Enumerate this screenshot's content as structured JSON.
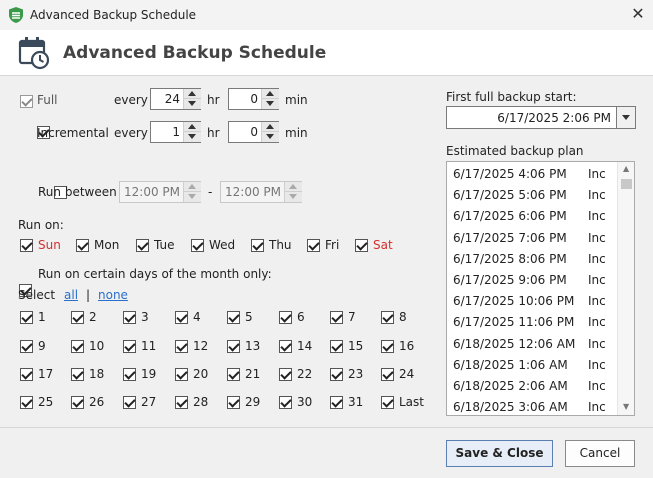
{
  "window": {
    "title": "Advanced Backup Schedule",
    "header_title": "Advanced Backup Schedule",
    "close_glyph": "✕",
    "accent_color": "#3a9a4a"
  },
  "full": {
    "label": "Full",
    "checked": true,
    "disabled": true,
    "every_label": "every",
    "hours": "24",
    "hr_label": "hr",
    "minutes": "0",
    "min_label": "min"
  },
  "incremental": {
    "label": "Incremental",
    "checked": true,
    "every_label": "every",
    "hours": "1",
    "hr_label": "hr",
    "minutes": "0",
    "min_label": "min"
  },
  "run_between": {
    "label": "Run between",
    "checked": false,
    "start": "12:00 PM",
    "separator": "-",
    "end": "12:00 PM"
  },
  "run_on": {
    "label": "Run on:",
    "days": [
      {
        "label": "Sun",
        "checked": true,
        "weekend": true
      },
      {
        "label": "Mon",
        "checked": true,
        "weekend": false
      },
      {
        "label": "Tue",
        "checked": true,
        "weekend": false
      },
      {
        "label": "Wed",
        "checked": true,
        "weekend": false
      },
      {
        "label": "Thu",
        "checked": true,
        "weekend": false
      },
      {
        "label": "Fri",
        "checked": true,
        "weekend": false
      },
      {
        "label": "Sat",
        "checked": true,
        "weekend": true
      }
    ]
  },
  "month_days": {
    "label": "Run on certain days of the month only:",
    "checked": true,
    "select_label": "Select",
    "all_link": "all",
    "divider": "|",
    "none_link": "none",
    "days": [
      "1",
      "2",
      "3",
      "4",
      "5",
      "6",
      "7",
      "8",
      "9",
      "10",
      "11",
      "12",
      "13",
      "14",
      "15",
      "16",
      "17",
      "18",
      "19",
      "20",
      "21",
      "22",
      "23",
      "24",
      "25",
      "26",
      "27",
      "28",
      "29",
      "30",
      "31",
      "Last"
    ]
  },
  "first_full": {
    "label": "First full backup start:",
    "value": "6/17/2025 2:06 PM"
  },
  "plan": {
    "label": "Estimated backup plan",
    "rows": [
      {
        "date": "6/17/2025 4:06 PM",
        "type": "Inc"
      },
      {
        "date": "6/17/2025 5:06 PM",
        "type": "Inc"
      },
      {
        "date": "6/17/2025 6:06 PM",
        "type": "Inc"
      },
      {
        "date": "6/17/2025 7:06 PM",
        "type": "Inc"
      },
      {
        "date": "6/17/2025 8:06 PM",
        "type": "Inc"
      },
      {
        "date": "6/17/2025 9:06 PM",
        "type": "Inc"
      },
      {
        "date": "6/17/2025 10:06 PM",
        "type": "Inc"
      },
      {
        "date": "6/17/2025 11:06 PM",
        "type": "Inc"
      },
      {
        "date": "6/18/2025 12:06 AM",
        "type": "Inc"
      },
      {
        "date": "6/18/2025 1:06 AM",
        "type": "Inc"
      },
      {
        "date": "6/18/2025 2:06 AM",
        "type": "Inc"
      },
      {
        "date": "6/18/2025 3:06 AM",
        "type": "Inc"
      }
    ]
  },
  "buttons": {
    "save": "Save & Close",
    "cancel": "Cancel"
  }
}
